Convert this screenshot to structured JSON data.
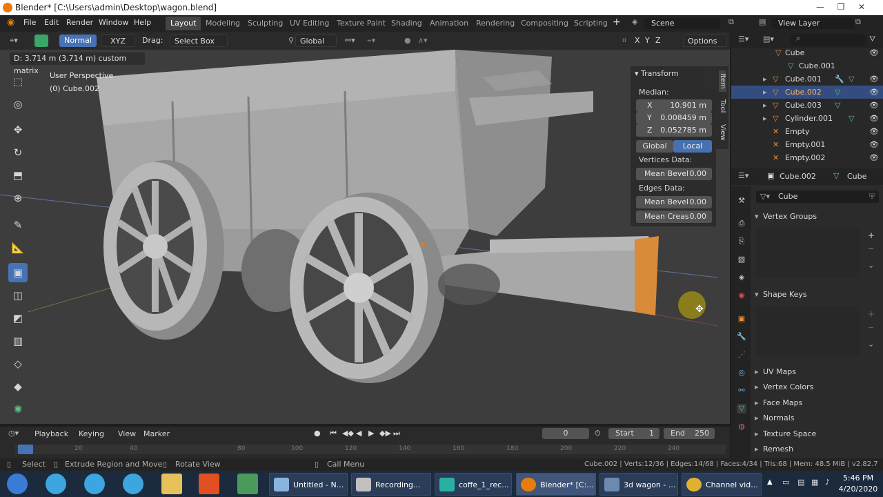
{
  "window": {
    "title": "Blender* [C:\\Users\\admin\\Desktop\\wagon.blend]",
    "controls": [
      "—",
      "❐",
      "✕"
    ]
  },
  "menubar": {
    "items": [
      "File",
      "Edit",
      "Render",
      "Window",
      "Help"
    ]
  },
  "workspaces": {
    "tabs": [
      "Layout",
      "Modeling",
      "Sculpting",
      "UV Editing",
      "Texture Paint",
      "Shading",
      "Animation",
      "Rendering",
      "Compositing",
      "Scripting"
    ],
    "active": "Layout",
    "add": "+",
    "scene_label": "Scene",
    "view_layer_label": "View Layer"
  },
  "viewport_header": {
    "mode": "Normal",
    "axis": "XYZ",
    "drag_label": "Drag:",
    "drag_value": "Select Box",
    "orientation": "Global",
    "options": "Options",
    "x": "X",
    "y": "Y",
    "z": "Z"
  },
  "viewport": {
    "operator_info": "D: 3.714 m (3.714 m) custom matrix",
    "perspective": "User Perspective",
    "object_name": "(0) Cube.002"
  },
  "npanel": {
    "header": "Transform",
    "median_label": "Median:",
    "fields": [
      {
        "axis": "X",
        "value": "10.901 m"
      },
      {
        "axis": "Y",
        "value": "0.008459 m"
      },
      {
        "axis": "Z",
        "value": "0.052785 m"
      }
    ],
    "global_label": "Global",
    "local_label": "Local",
    "vertices_data_label": "Vertices Data:",
    "mean_bevel_label": "Mean Bevel",
    "mean_bevel_value": "0.00",
    "edges_data_label": "Edges Data:",
    "edge_mean_bevel_label": "Mean Bevel",
    "edge_mean_bevel_value": "0.00",
    "mean_crease_label": "Mean Creas",
    "mean_crease_value": "0.00",
    "tabs": [
      "Item",
      "Tool",
      "View"
    ]
  },
  "timeline": {
    "menus": [
      "Playback",
      "Keying",
      "View",
      "Marker"
    ],
    "current_frame": "0",
    "start_label": "Start",
    "start_value": "1",
    "end_label": "End",
    "end_value": "250",
    "ruler": [
      "20",
      "40",
      "80",
      "100",
      "120",
      "140",
      "160",
      "180",
      "200",
      "220",
      "240"
    ]
  },
  "statusbar": {
    "select": "Select",
    "extrude": "Extrude Region and Move",
    "rotate": "Rotate View",
    "call_menu": "Call Menu",
    "stats": "Cube.002 | Verts:12/36 | Edges:14/68 | Faces:4/34 | Tris:68 | Mem: 48.5 MiB | v2.82.7"
  },
  "outliner": {
    "rows": [
      {
        "name": "Cube",
        "indent": 0,
        "selected": false
      },
      {
        "name": "Cube.001",
        "indent": 1,
        "selected": false
      },
      {
        "name": "Cube.001",
        "indent": 0,
        "selected": false
      },
      {
        "name": "Cube.002",
        "indent": 0,
        "selected": true
      },
      {
        "name": "Cube.003",
        "indent": 0,
        "selected": false
      },
      {
        "name": "Cylinder.001",
        "indent": 0,
        "selected": false
      },
      {
        "name": "Empty",
        "indent": 0,
        "selected": false
      },
      {
        "name": "Empty.001",
        "indent": 0,
        "selected": false
      },
      {
        "name": "Empty.002",
        "indent": 0,
        "selected": false
      }
    ]
  },
  "properties": {
    "object_name": "Cube.002",
    "mesh_name": "Cube",
    "data_field": "Cube",
    "vertex_groups": "Vertex Groups",
    "shape_keys": "Shape Keys",
    "sections": [
      "UV Maps",
      "Vertex Colors",
      "Face Maps",
      "Normals",
      "Texture Space",
      "Remesh"
    ]
  },
  "taskbar": {
    "tasks": [
      "Untitled - N...",
      "Recording...",
      "coffe_1_rec...",
      "Blender* [C:...",
      "3d wagon - ...",
      "Channel vid..."
    ],
    "time": "5:46 PM",
    "date": "4/20/2020"
  },
  "colors": {
    "accent": "#4772b3",
    "selection": "#334d80",
    "edge_orange": "#e87d0d"
  }
}
